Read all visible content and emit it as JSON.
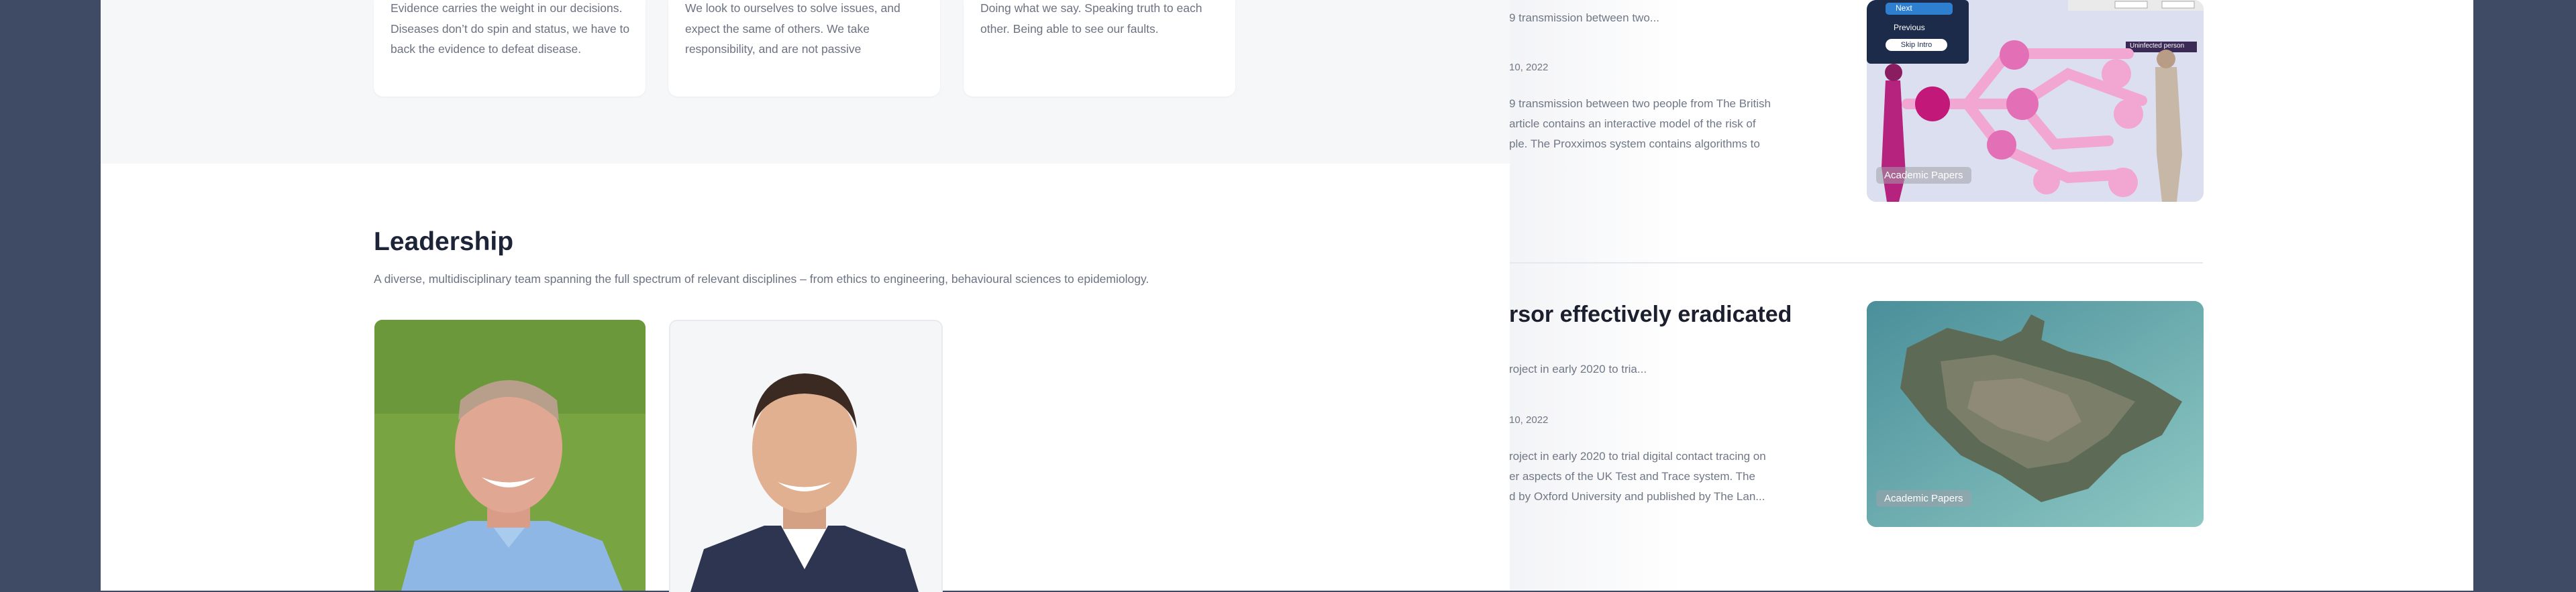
{
  "values_cards": [
    {
      "text": "Evidence carries the weight in our decisions. Diseases don’t do spin and status, we have to back the evidence to defeat disease."
    },
    {
      "text": "We look to ourselves to solve issues, and expect the same of others. We take responsibility, and are not passive"
    },
    {
      "text": "Doing what we say. Speaking truth to each other. Being able to see our faults."
    }
  ],
  "leadership": {
    "title": "Leadership",
    "subtitle": "A diverse, multidisciplinary team spanning the full spectrum of relevant disciplines – from ethics to engineering, behavioural sciences to epidemiology."
  },
  "articles": [
    {
      "excerpt_short": "9 transmission between two...",
      "date": "10, 2022",
      "excerpt_lines": [
        "9 transmission between two people from The British",
        "article contains an interactive model of the risk of",
        "ple.  The Proxximos system contains algorithms to"
      ],
      "tag": "Academic Papers",
      "thumb_labels": {
        "next": "Next",
        "previous": "Previous",
        "skip": "Skip Intro",
        "uninfected": "Uninfected person"
      }
    },
    {
      "title": "rsor effectively eradicated",
      "excerpt_short": "roject in early 2020 to tria...",
      "date": "10, 2022",
      "excerpt_lines": [
        "roject in early 2020 to trial digital contact tracing on",
        "er aspects of the UK Test and Trace system.  The",
        "d by Oxford University and published by The Lan..."
      ],
      "tag": "Academic Papers"
    }
  ],
  "colors": {
    "backdrop": "#3f4a64",
    "heading": "#1d2438",
    "muted_text": "#6c7281",
    "infographic_pink": "#e36fb6"
  }
}
